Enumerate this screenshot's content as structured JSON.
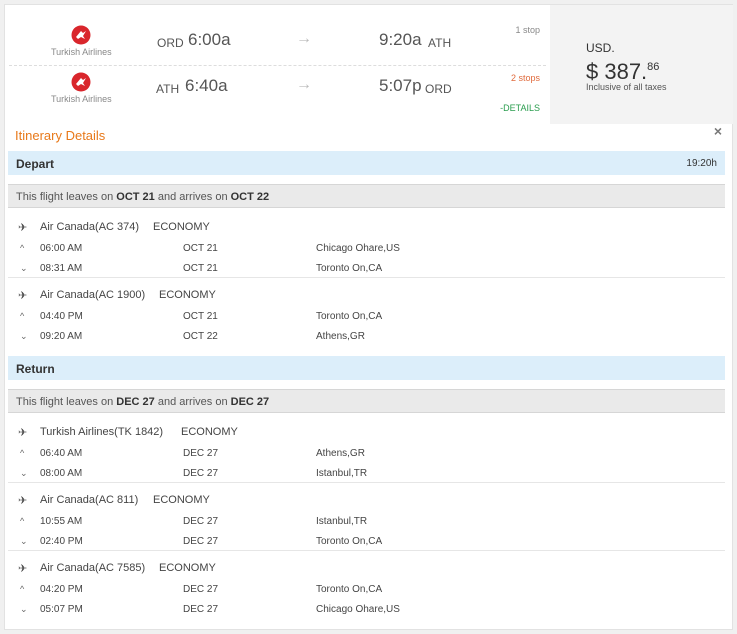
{
  "summary": {
    "outbound": {
      "airline": "Turkish Airlines",
      "from_code": "ORD",
      "depart_time": "6:00a",
      "arrow": "→",
      "arrive_time": "9:20a",
      "to_code": "ATH",
      "stops": "1 stop"
    },
    "inbound": {
      "airline": "Turkish Airlines",
      "from_code": "ATH",
      "depart_time": "6:40a",
      "arrow": "→",
      "arrive_time": "5:07p",
      "to_code": "ORD",
      "stops": "2 stops"
    },
    "details_link": "-DETAILS",
    "price": {
      "currency": "USD.",
      "amount": "$ 387.",
      "cents": "86",
      "note": "Inclusive of all taxes"
    },
    "colors": {
      "brand_red": "#d9262c",
      "accent_orange": "#e8791a",
      "details_green": "#2a9d4e",
      "section_blue": "#dceefa"
    }
  },
  "itinerary": {
    "title": "Itinerary Details",
    "close": "×",
    "depart": {
      "label": "Depart",
      "duration": "19:20h",
      "leaves_prefix": "This flight leaves on ",
      "leaves_date": "OCT 21",
      "arrives_mid": " and arrives on ",
      "arrives_date": "OCT 22",
      "segments": [
        {
          "carrier": "Air Canada(AC 374)",
          "cabin": "ECONOMY",
          "dep_time": "06:00 AM",
          "dep_date": "OCT 21",
          "dep_city": "Chicago Ohare,US",
          "arr_time": "08:31 AM",
          "arr_date": "OCT 21",
          "arr_city": "Toronto On,CA"
        },
        {
          "carrier": "Air Canada(AC 1900)",
          "cabin": "ECONOMY",
          "dep_time": "04:40 PM",
          "dep_date": "OCT 21",
          "dep_city": "Toronto On,CA",
          "arr_time": "09:20 AM",
          "arr_date": "OCT 22",
          "arr_city": "Athens,GR"
        }
      ]
    },
    "return": {
      "label": "Return",
      "leaves_prefix": "This flight leaves on ",
      "leaves_date": "DEC 27",
      "arrives_mid": " and arrives on ",
      "arrives_date": "DEC 27",
      "segments": [
        {
          "carrier": "Turkish Airlines(TK 1842)",
          "cabin": "ECONOMY",
          "dep_time": "06:40 AM",
          "dep_date": "DEC 27",
          "dep_city": "Athens,GR",
          "arr_time": "08:00 AM",
          "arr_date": "DEC 27",
          "arr_city": "Istanbul,TR"
        },
        {
          "carrier": "Air Canada(AC 811)",
          "cabin": "ECONOMY",
          "dep_time": "10:55 AM",
          "dep_date": "DEC 27",
          "dep_city": "Istanbul,TR",
          "arr_time": "02:40 PM",
          "arr_date": "DEC 27",
          "arr_city": "Toronto On,CA"
        },
        {
          "carrier": "Air Canada(AC 7585)",
          "cabin": "ECONOMY",
          "dep_time": "04:20 PM",
          "dep_date": "DEC 27",
          "dep_city": "Toronto On,CA",
          "arr_time": "05:07 PM",
          "arr_date": "DEC 27",
          "arr_city": "Chicago Ohare,US"
        }
      ]
    },
    "icons": {
      "plane": "plane-icon",
      "caret_up": "caret-up-icon",
      "caret_down": "caret-down-icon"
    }
  }
}
